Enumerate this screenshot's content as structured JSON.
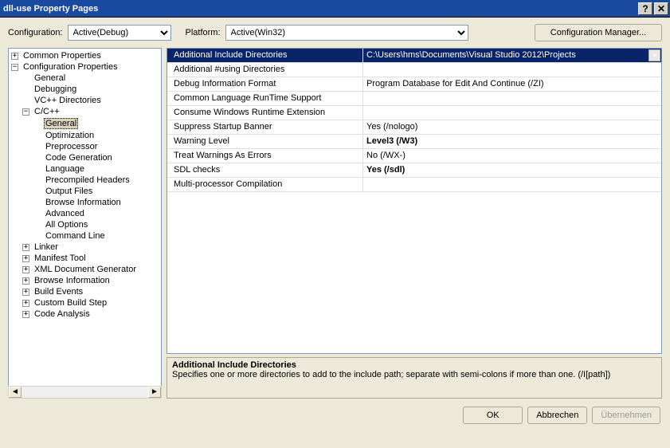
{
  "title": "dll-use Property Pages",
  "toolbar": {
    "config_label": "Configuration:",
    "config_value": "Active(Debug)",
    "platform_label": "Platform:",
    "platform_value": "Active(Win32)",
    "config_mgr": "Configuration Manager..."
  },
  "tree": {
    "common": "Common Properties",
    "configprops": "Configuration Properties",
    "general": "General",
    "debugging": "Debugging",
    "vcdirs": "VC++ Directories",
    "ccpp": "C/C++",
    "ccpp_general": "General",
    "optimization": "Optimization",
    "preprocessor": "Preprocessor",
    "codegen": "Code Generation",
    "language": "Language",
    "precomp": "Precompiled Headers",
    "output": "Output Files",
    "browseinfo": "Browse Information",
    "advanced": "Advanced",
    "allopts": "All Options",
    "cmdline": "Command Line",
    "linker": "Linker",
    "manifest": "Manifest Tool",
    "xmldoc": "XML Document Generator",
    "browseinfo2": "Browse Information",
    "buildevents": "Build Events",
    "custombuild": "Custom Build Step",
    "codeanalysis": "Code Analysis"
  },
  "grid": [
    {
      "key": "Additional Include Directories",
      "val": "C:\\Users\\hms\\Documents\\Visual Studio 2012\\Projects",
      "selected": true,
      "bold": false,
      "dd": true
    },
    {
      "key": "Additional #using Directories",
      "val": "",
      "bold": false
    },
    {
      "key": "Debug Information Format",
      "val": "Program Database for Edit And Continue (/ZI)",
      "bold": false
    },
    {
      "key": "Common Language RunTime Support",
      "val": "",
      "bold": false
    },
    {
      "key": "Consume Windows Runtime Extension",
      "val": "",
      "bold": false
    },
    {
      "key": "Suppress Startup Banner",
      "val": "Yes (/nologo)",
      "bold": false
    },
    {
      "key": "Warning Level",
      "val": "Level3 (/W3)",
      "bold": true
    },
    {
      "key": "Treat Warnings As Errors",
      "val": "No (/WX-)",
      "bold": false
    },
    {
      "key": "SDL checks",
      "val": "Yes (/sdl)",
      "bold": true
    },
    {
      "key": "Multi-processor Compilation",
      "val": "",
      "bold": false
    }
  ],
  "desc": {
    "title": "Additional Include Directories",
    "body": "Specifies one or more directories to add to the include path; separate with semi-colons if more than one.     (/I[path])"
  },
  "buttons": {
    "ok": "OK",
    "cancel": "Abbrechen",
    "apply": "Übernehmen"
  }
}
